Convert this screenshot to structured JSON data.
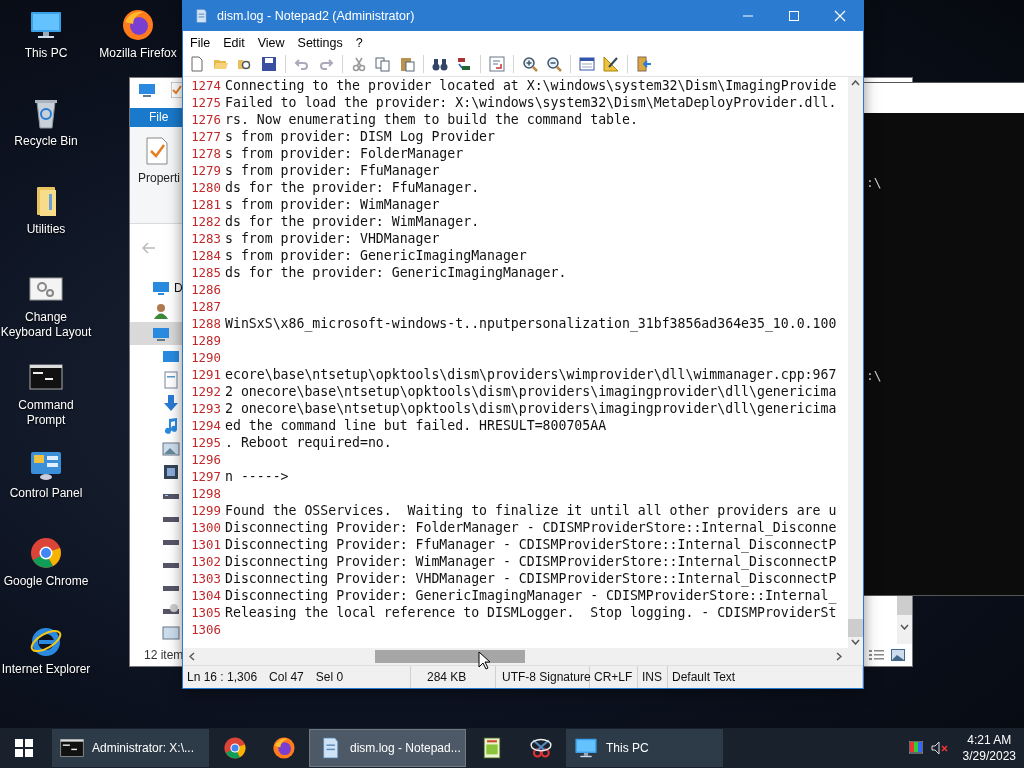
{
  "desktop": {
    "icons": [
      {
        "kind": "this-pc",
        "label": "This PC"
      },
      {
        "kind": "firefox",
        "label": "Mozilla Firefox"
      },
      {
        "kind": "recycle-bin",
        "label": "Recycle Bin"
      },
      {
        "kind": "folder",
        "label": "Utilities"
      },
      {
        "kind": "keyboard-settings",
        "label": "Change Keyboard Layout"
      },
      {
        "kind": "console",
        "label": "Command Prompt"
      },
      {
        "kind": "control-panel",
        "label": "Control Panel"
      },
      {
        "kind": "chrome",
        "label": "Google Chrome"
      },
      {
        "kind": "ie",
        "label": "Internet Explorer"
      }
    ]
  },
  "explorer": {
    "ribbon_tab": "File",
    "ribbon_button": "Properti",
    "nav_item": "D",
    "status": "12 item"
  },
  "console": {
    "lines": [
      ":\\",
      ":\\"
    ]
  },
  "notepad": {
    "title": "dism.log - Notepad2 (Administrator)",
    "menu": [
      "File",
      "Edit",
      "View",
      "Settings",
      "?"
    ],
    "lines": [
      {
        "number": "1274",
        "text": "Connecting to the provider located at X:\\windows\\system32\\Dism\\ImagingProvide"
      },
      {
        "number": "1275",
        "text": "Failed to load the provider: X:\\windows\\system32\\Dism\\MetaDeployProvider.dll."
      },
      {
        "number": "1276",
        "text": "rs. Now enumerating them to build the command table."
      },
      {
        "number": "1277",
        "text": "s from provider: DISM Log Provider"
      },
      {
        "number": "1278",
        "text": "s from provider: FolderManager"
      },
      {
        "number": "1279",
        "text": "s from provider: FfuManager"
      },
      {
        "number": "1280",
        "text": "ds for the provider: FfuManager."
      },
      {
        "number": "1281",
        "text": "s from provider: WimManager"
      },
      {
        "number": "1282",
        "text": "ds for the provider: WimManager."
      },
      {
        "number": "1283",
        "text": "s from provider: VHDManager"
      },
      {
        "number": "1284",
        "text": "s from provider: GenericImagingManager"
      },
      {
        "number": "1285",
        "text": "ds for the provider: GenericImagingManager."
      },
      {
        "number": "1286"
      },
      {
        "number": "1287"
      },
      {
        "number": "1288",
        "text": "WinSxS\\x86_microsoft-windows-t..nputpersonalization_31bf3856ad364e35_10.0.100"
      },
      {
        "number": "1289"
      },
      {
        "number": "1290"
      },
      {
        "number": "1291",
        "text": "ecore\\base\\ntsetup\\opktools\\dism\\providers\\wimprovider\\dll\\wimmanager.cpp:967"
      },
      {
        "number": "1292",
        "text": "2 onecore\\base\\ntsetup\\opktools\\dism\\providers\\imagingprovider\\dll\\genericima"
      },
      {
        "number": "1293",
        "text": "2 onecore\\base\\ntsetup\\opktools\\dism\\providers\\imagingprovider\\dll\\genericima"
      },
      {
        "number": "1294",
        "text": "ed the command line but failed. HRESULT=800705AA"
      },
      {
        "number": "1295",
        "text": ". Reboot required=no."
      },
      {
        "number": "1296"
      },
      {
        "number": "1297",
        "text": "n ----->"
      },
      {
        "number": "1298"
      },
      {
        "number": "1299",
        "text": "Found the OSServices.  Waiting to finalize it until all other providers are u"
      },
      {
        "number": "1300",
        "text": "Disconnecting Provider: FolderManager - CDISMProviderStore::Internal_Disconne"
      },
      {
        "number": "1301",
        "text": "Disconnecting Provider: FfuManager - CDISMProviderStore::Internal_DisconnectP"
      },
      {
        "number": "1302",
        "text": "Disconnecting Provider: WimManager - CDISMProviderStore::Internal_DisconnectP"
      },
      {
        "number": "1303",
        "text": "Disconnecting Provider: VHDManager - CDISMProviderStore::Internal_DisconnectP"
      },
      {
        "number": "1304",
        "text": "Disconnecting Provider: GenericImagingManager - CDISMProviderStore::Internal_"
      },
      {
        "number": "1305",
        "text": "Releasing the local reference to DISMLogger.  Stop logging. - CDISMProviderSt"
      },
      {
        "number": "1306"
      }
    ],
    "status_bar": [
      "Ln 16 : 1,306",
      "Col 47",
      "Sel 0",
      "284 KB",
      "UTF-8 Signature",
      "CR+LF",
      "INS",
      "Default Text"
    ]
  },
  "taskbar": {
    "buttons": [
      {
        "kind": "window",
        "label": "Administrator: X:\\...",
        "selected": false
      },
      {
        "kind": "pinned",
        "selected": false
      },
      {
        "kind": "pinned",
        "selected": false
      },
      {
        "kind": "window",
        "label": "dism.log - Notepad...",
        "selected": true
      },
      {
        "kind": "pinned",
        "selected": false
      },
      {
        "kind": "pinned",
        "selected": false
      },
      {
        "kind": "window",
        "label": "This PC",
        "selected": false
      }
    ],
    "volume": {
      "muted": true
    },
    "clock": {
      "time": "4:21 AM",
      "date": "3/29/2023"
    }
  }
}
